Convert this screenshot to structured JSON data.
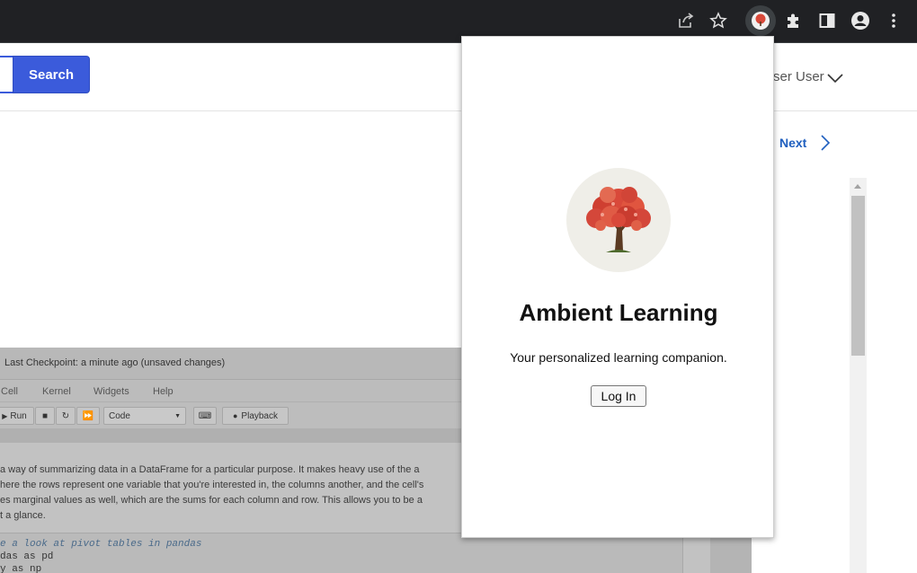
{
  "browser": {
    "icons": [
      "share-icon",
      "bookmark-star-icon",
      "ambient-learning-extension-icon",
      "extensions-puzzle-icon",
      "side-panel-icon",
      "profile-icon",
      "more-menu-icon"
    ]
  },
  "header": {
    "search_button": "Search",
    "user_label": "ser User",
    "next_label": "Next"
  },
  "notebook": {
    "checkpoint": "Last Checkpoint: a minute ago   (unsaved changes)",
    "menu": [
      "Cell",
      "Kernel",
      "Widgets",
      "Help"
    ],
    "toolbar": {
      "run": "Run",
      "cell_type": "Code",
      "playback": "Playback"
    },
    "text_lines": [
      "a way of summarizing data in a DataFrame for a particular purpose. It makes heavy use of the a",
      "here the rows represent one variable that you're interested in, the columns another, and the cell's",
      "es marginal values as well, which are the sums for each column and row. This allows you to be a",
      "t a glance."
    ],
    "code_lines": [
      "e a look at pivot tables in pandas",
      "das as pd",
      "y as np"
    ]
  },
  "popup": {
    "title": "Ambient Learning",
    "tagline": "Your personalized learning companion.",
    "login_button": "Log In"
  },
  "colors": {
    "toolbar_bg": "#202124",
    "search_button": "#3b5bdb",
    "next_link": "#1f5fbf",
    "tree_foliage": "#d9493a"
  }
}
